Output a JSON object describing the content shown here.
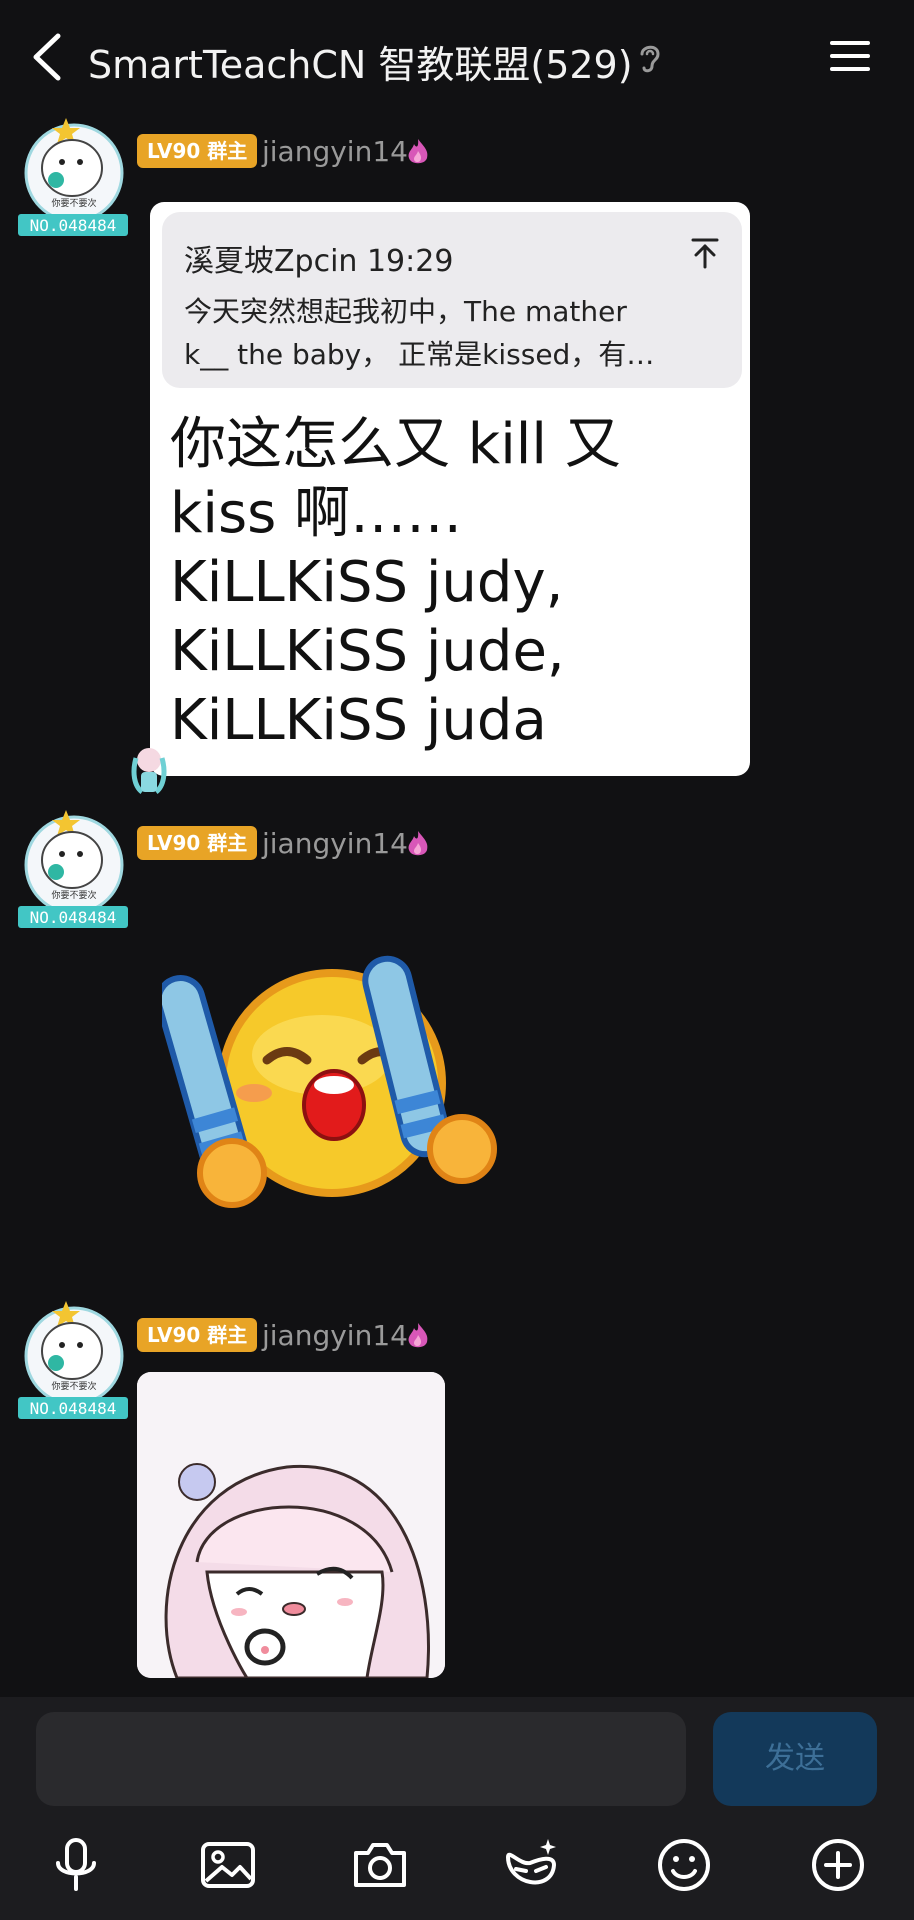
{
  "header": {
    "title": "SmartTeachCN 智教联盟(529)",
    "icons": [
      "back-chevron-icon",
      "ear-icon",
      "menu-icon"
    ]
  },
  "messages": [
    {
      "badge": "LV90 群主",
      "username": "jiangyin14",
      "avatar_tag": "NO.048484",
      "avatar_caption": "你要不要次",
      "quote": {
        "sender_time": "溪夏坡Zpcin 19:29",
        "line1": "今天突然想起我初中，The mather",
        "line2": "k__ the baby， 正常是kissed，有…"
      },
      "text_lines": [
        "你这怎么又 kill 又",
        "kiss 啊……",
        "KiLLKiSS judy,",
        "KiLLKiSS jude,",
        "KiLLKiSS juda"
      ]
    },
    {
      "badge": "LV90 群主",
      "username": "jiangyin14",
      "avatar_tag": "NO.048484",
      "avatar_caption": "你要不要次",
      "content": "cheering-emoji-sticker"
    },
    {
      "badge": "LV90 群主",
      "username": "jiangyin14",
      "avatar_tag": "NO.048484",
      "avatar_caption": "你要不要次",
      "content": "anime-girl-crying-sticker"
    }
  ],
  "composer": {
    "input_value": "",
    "send_label": "发送",
    "tools": [
      "microphone-icon",
      "image-icon",
      "camera-icon",
      "ai-face-icon",
      "emoji-icon",
      "plus-icon"
    ]
  },
  "colors": {
    "background": "#111113",
    "badge": "#e8a426",
    "send_button": "#13395a",
    "flame": "#d857b8"
  }
}
